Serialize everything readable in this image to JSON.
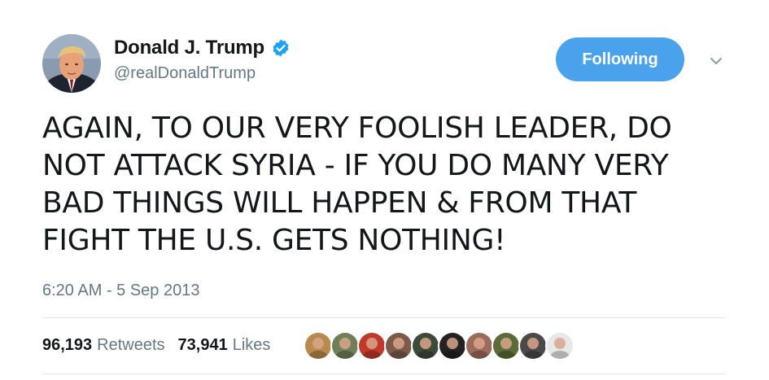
{
  "author": {
    "display_name": "Donald J. Trump",
    "handle": "@realDonaldTrump",
    "verified": true,
    "verified_color": "#1da1f2",
    "avatar_icon": "profile-photo"
  },
  "follow_button": {
    "label": "Following",
    "color": "#4aa1ec"
  },
  "menu_icon": "chevron-down-icon",
  "tweet": {
    "text": "AGAIN, TO OUR VERY FOOLISH LEADER, DO NOT ATTACK SYRIA - IF YOU DO MANY VERY BAD THINGS WILL HAPPEN & FROM THAT FIGHT THE U.S. GETS NOTHING!",
    "timestamp": "6:20 AM - 5 Sep 2013"
  },
  "stats": {
    "retweets_count": "96,193",
    "retweets_label": "Retweets",
    "likes_count": "73,941",
    "likes_label": "Likes"
  },
  "likers": [
    {
      "name": "liker-avatar-1",
      "color": "#b88a4c"
    },
    {
      "name": "liker-avatar-2",
      "color": "#6f7f5a"
    },
    {
      "name": "liker-avatar-3",
      "color": "#c0392b"
    },
    {
      "name": "liker-avatar-4",
      "color": "#7b5a4a"
    },
    {
      "name": "liker-avatar-5",
      "color": "#3d4a3a"
    },
    {
      "name": "liker-avatar-6",
      "color": "#222222"
    },
    {
      "name": "liker-avatar-7",
      "color": "#9b6b5c"
    },
    {
      "name": "liker-avatar-8",
      "color": "#5c6b3a"
    },
    {
      "name": "liker-avatar-9",
      "color": "#4a4a4a"
    },
    {
      "name": "liker-avatar-10",
      "color": "#e8e8e8"
    }
  ]
}
